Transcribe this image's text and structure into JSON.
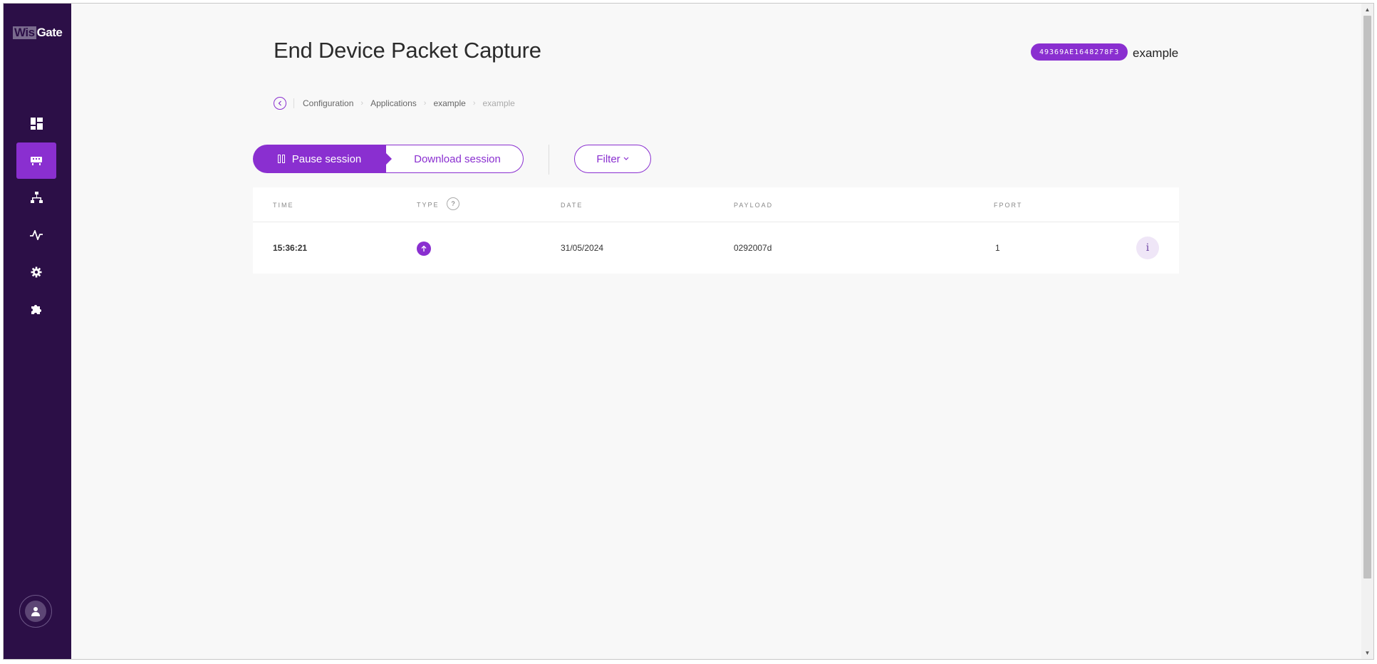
{
  "app": {
    "logo_part1": "Wis",
    "logo_part2": "Gate"
  },
  "sidebar": {
    "items": [
      {
        "name": "dashboard",
        "icon": "dashboard-icon"
      },
      {
        "name": "gateways",
        "icon": "gateway-icon",
        "active": true
      },
      {
        "name": "applications",
        "icon": "network-icon"
      },
      {
        "name": "activity",
        "icon": "activity-icon"
      },
      {
        "name": "settings",
        "icon": "gear-icon"
      },
      {
        "name": "extensions",
        "icon": "puzzle-icon"
      }
    ],
    "avatar_icon": "user-icon"
  },
  "header": {
    "title": "End Device Packet Capture",
    "device_eui": "49369AE1648278F3",
    "device_name": "example"
  },
  "breadcrumb": {
    "items": [
      "Configuration",
      "Applications",
      "example",
      "example"
    ]
  },
  "controls": {
    "pause_label": "Pause session",
    "download_label": "Download session",
    "filter_label": "Filter"
  },
  "table": {
    "columns": [
      "TIME",
      "TYPE",
      "DATE",
      "PAYLOAD",
      "FPORT"
    ],
    "type_help": "?",
    "rows": [
      {
        "time": "15:36:21",
        "type": "uplink",
        "date": "31/05/2024",
        "payload": "0292007d",
        "fport": "1",
        "info": "i"
      }
    ]
  },
  "colors": {
    "accent": "#8a2fd0",
    "sidebar": "#2c0f47"
  }
}
